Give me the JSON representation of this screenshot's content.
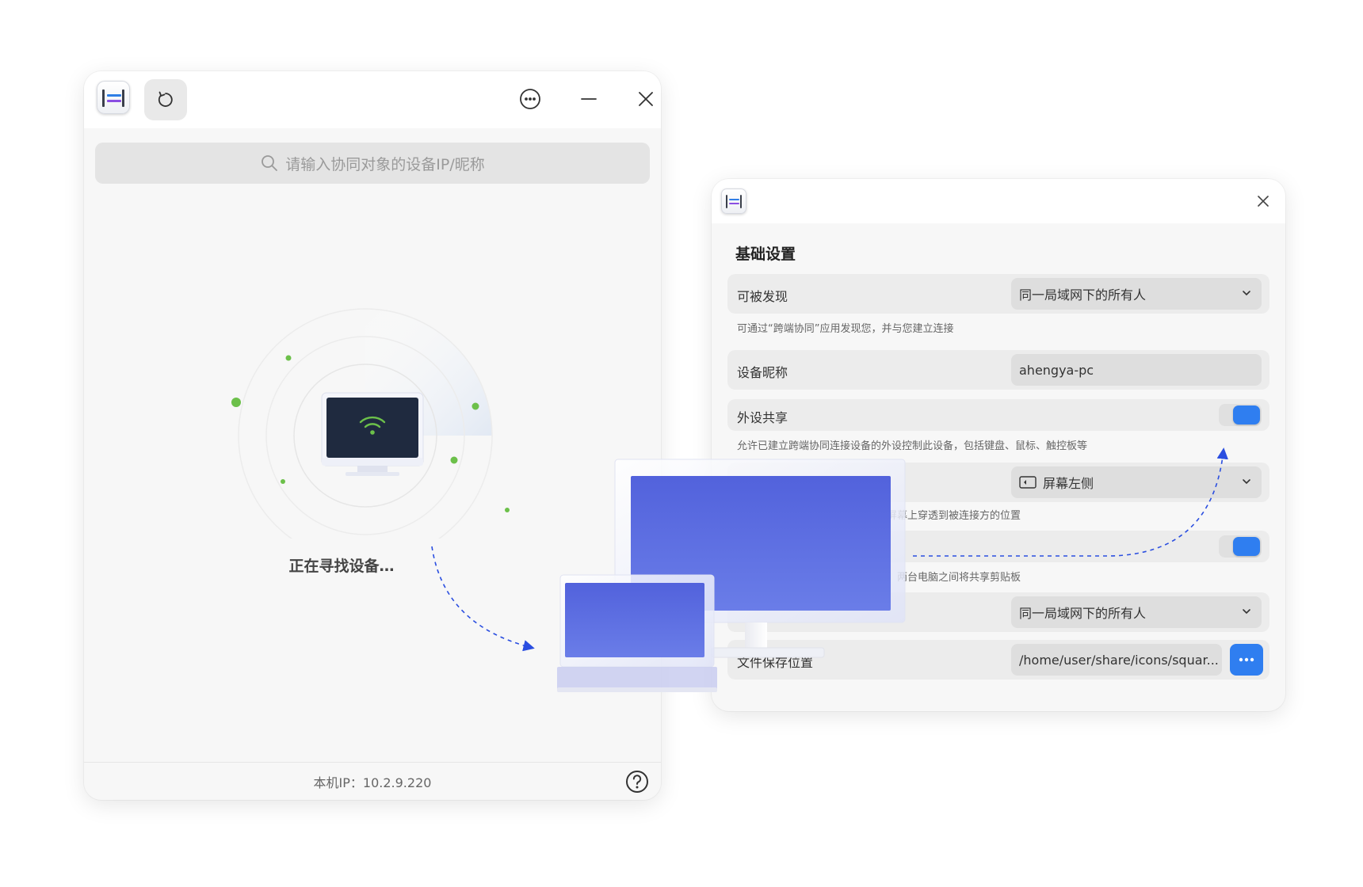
{
  "main_window": {
    "search": {
      "placeholder": "请输入协同对象的设备IP/昵称"
    },
    "status_text": "正在寻找设备…",
    "footer_ip": "本机IP：10.2.9.220"
  },
  "settings_window": {
    "section_title": "基础设置",
    "discoverable": {
      "label": "可被发现",
      "value": "同一局域网下的所有人",
      "description": "可通过“跨端协同”应用发现您，并与您建立连接"
    },
    "device_name": {
      "label": "设备昵称",
      "value": "ahengya-pc"
    },
    "peripheral_sharing": {
      "label": "外设共享",
      "enabled": true,
      "description": "允许已建立跨端协同连接设备的外设控制此设备，包括键盘、鼠标、触控板等"
    },
    "screen_position": {
      "value": "屏幕左侧",
      "description_visible": "备屏幕上穿透到被连接方的位置"
    },
    "clipboard_sharing": {
      "enabled": true,
      "description_visible": "后，两台电脑之间将共享剪贴板"
    },
    "file_transfer": {
      "value": "同一局域网下的所有人"
    },
    "file_save_location": {
      "label": "文件保存位置",
      "value": "/home/user/share/icons/squar..."
    }
  },
  "colors": {
    "accent": "#2f7ef0",
    "device_screen": "#5b6de0",
    "radar_dot": "#6cc04a",
    "arrow": "#2a4ee0"
  },
  "icons": {
    "app": "cooperation-app-icon",
    "refresh": "refresh-icon",
    "menu": "more-circle-icon",
    "minimize": "minimize-icon",
    "close": "close-icon",
    "search": "search-icon",
    "help": "help-icon",
    "browse": "more-dots-icon",
    "screen_side": "screen-left-icon"
  }
}
